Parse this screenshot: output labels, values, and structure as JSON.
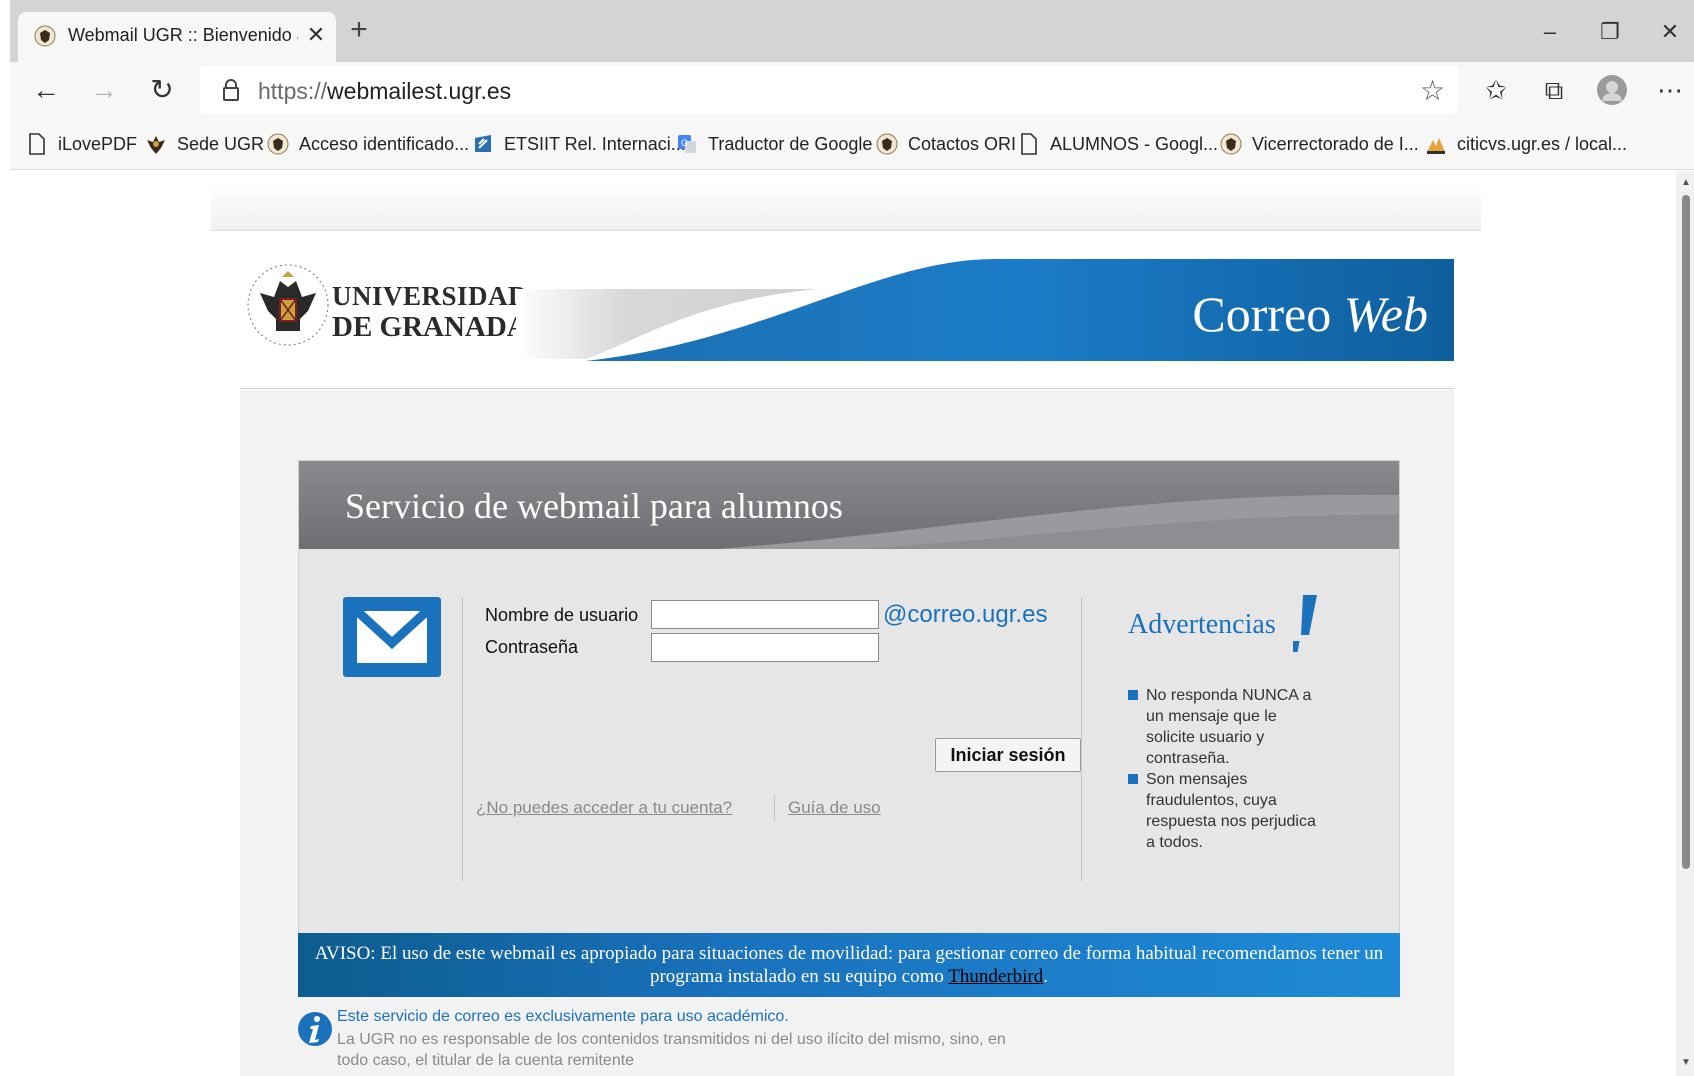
{
  "browser": {
    "tab_title": "Webmail UGR :: Bienvenido a We",
    "new_tab_icon": "plus-icon",
    "url_scheme": "https://",
    "url_host": "webmailest.ugr.es",
    "bookmarks": [
      "iLovePDF",
      "Sede UGR",
      "Acceso identificado...",
      "ETSIIT Rel. Internaci...",
      "Traductor de Google",
      "Cotactos ORI",
      "ALUMNOS - Googl...",
      "Vicerrectorado de I...",
      "citicvs.ugr.es / local..."
    ]
  },
  "header": {
    "university_line1": "UNIVERSIDAD",
    "university_line2": "DE GRANADA",
    "product_regular": "Correo ",
    "product_italic": "Web"
  },
  "panel": {
    "title": "Servicio de webmail para alumnos",
    "username_label": "Nombre de usuario",
    "password_label": "Contraseña",
    "username_value": "",
    "password_value": "",
    "domain_suffix": "@correo.ugr.es",
    "login_button": "Iniciar sesión",
    "link_no_access": "¿No puedes acceder a tu cuenta?",
    "link_guide": "Guía de uso"
  },
  "warnings": {
    "title": "Advertencias",
    "items": [
      "No responda NUNCA a un mensaje que le solicite usuario y contraseña.",
      "Son mensajes fraudulentos, cuya respuesta nos perjudica a todos."
    ]
  },
  "notice": {
    "text": "AVISO: El uso de este webmail es apropiado para situaciones de movilidad: para gestionar correo de forma habitual recomendamos tener un programa instalado en su equipo como ",
    "link": "Thunderbird",
    "end": "."
  },
  "info": {
    "line1": "Este servicio de correo es exclusivamente para uso académico.",
    "line2": "La UGR no es responsable de los contenidos transmitidos ni del uso ilícito del mismo, sino, en todo caso, el titular de la cuenta remitente"
  },
  "colors": {
    "brand_blue": "#1a72bd",
    "panel_header_gray": "#7a7a7a"
  }
}
